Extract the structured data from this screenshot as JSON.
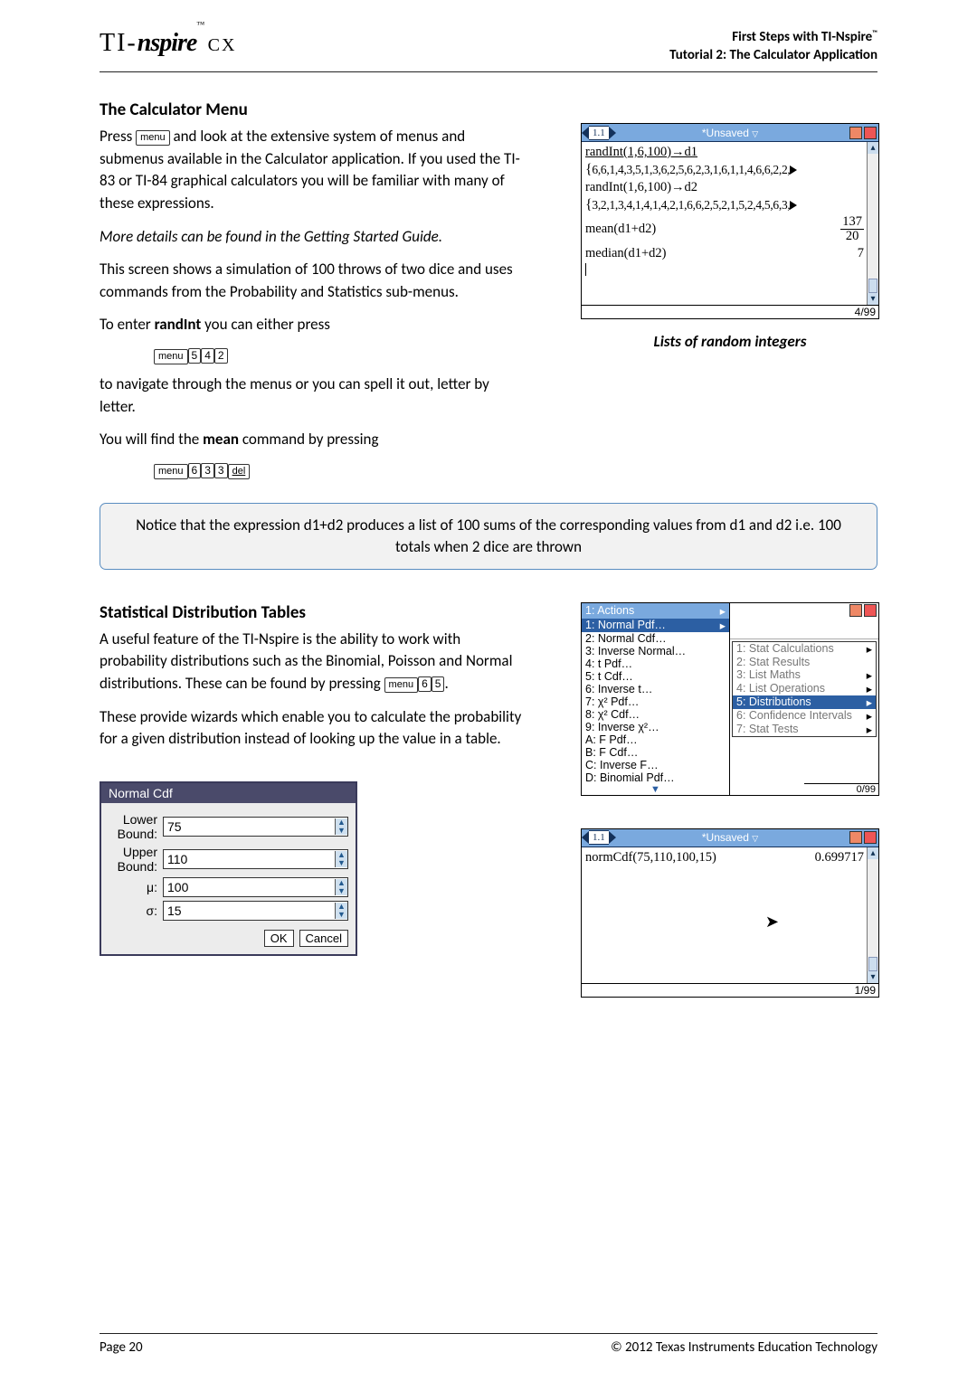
{
  "header": {
    "logo_ti": "TI-",
    "logo_nspire": "nspire",
    "logo_cx": "CX",
    "right_line1": "First Steps with TI-Nspire",
    "right_line2": "Tutorial 2: The Calculator Application"
  },
  "section1": {
    "title": "The Calculator Menu",
    "p1a": "Press ",
    "p1b": " and look at the extensive system of menus and submenus available in the Calculator application. If you used the TI-83 or TI-84 graphical calculators you will be familiar with many of these expressions.",
    "p2": "More details can be found in the Getting Started Guide.",
    "p3": "This screen shows a simulation of 100 throws of two dice and uses commands from the Probability and Statistics sub-menus.",
    "p4a": "To enter ",
    "p4b": "randInt",
    "p4c": " you can either press",
    "p5": "to navigate through the menus or you can spell it out, letter by letter.",
    "p6a": "You will find the ",
    "p6b": "mean",
    "p6c": " command by pressing"
  },
  "shot1": {
    "tab": "1.1",
    "title_center": "*Unsaved",
    "line1": "randInt(1,6,100)→d1",
    "list1": "6,6,1,4,3,5,1,3,6,2,5,6,2,3,1,6,1,1,4,6,6,2,2,",
    "line2": "randInt(1,6,100)→d2",
    "list2": "3,2,1,3,4,1,4,1,4,2,1,6,6,2,5,2,1,5,2,4,5,6,3,",
    "mean_lhs": "mean(d1+d2)",
    "mean_num": "137",
    "mean_den": "20",
    "median_lhs": "median(d1+d2)",
    "median_rhs": "7",
    "status": "4/99",
    "caption": "Lists of random integers"
  },
  "callout": "Notice that the expression d1+d2 produces a list of 100 sums of the corresponding values from d1 and d2 i.e. 100 totals when 2 dice are thrown",
  "section2": {
    "title": "Statistical Distribution Tables",
    "p1a": "A useful feature of the TI-Nspire is the ability to work with probability distributions such as the Binomial, Poisson and Normal distributions.  These can be found by pressing ",
    "p1b": ".",
    "p2": "These provide wizards which enable you to calculate the probability for a given distribution instead of looking up the value in a table."
  },
  "shot2": {
    "head": "1: Actions",
    "left": [
      "1: Normal Pdf…",
      "2: Normal Cdf…",
      "3: Inverse Normal…",
      "4: t Pdf…",
      "5: t Cdf…",
      "6: Inverse t…",
      "7: χ² Pdf…",
      "8: χ² Cdf…",
      "9: Inverse χ²…",
      "A: F Pdf…",
      "B: F Cdf…",
      "C: Inverse F…",
      "D: Binomial Pdf…"
    ],
    "right": [
      "1: Stat Calculations",
      "2: Stat Results",
      "3: List Maths",
      "4: List Operations",
      "5: Distributions",
      "6: Confidence Intervals",
      "7: Stat Tests"
    ],
    "status": "0/99"
  },
  "wizard": {
    "title": "Normal Cdf",
    "lower_label": "Lower Bound:",
    "lower_value": "75",
    "upper_label": "Upper Bound:",
    "upper_value": "110",
    "mu_label": "μ:",
    "mu_value": "100",
    "sigma_label": "σ:",
    "sigma_value": "15",
    "ok": "OK",
    "cancel": "Cancel"
  },
  "shot3": {
    "tab": "1.1",
    "title_center": "*Unsaved",
    "expr": "normCdf(75,110,100,15)",
    "result": "0.699717",
    "status": "1/99"
  },
  "footer": {
    "page": "Page  20",
    "copyright": "© 2012 Texas Instruments Education Technology"
  }
}
